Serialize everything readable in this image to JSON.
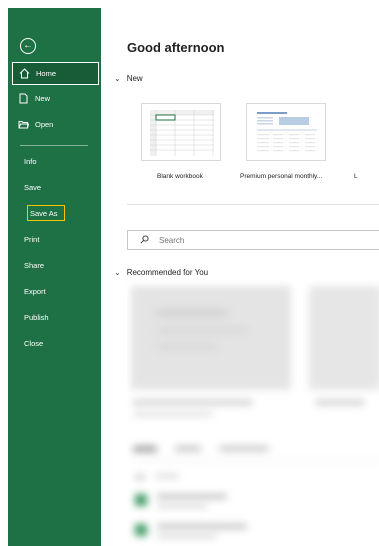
{
  "sidebar": {
    "back_icon": "back-arrow-icon",
    "top_items": [
      {
        "label": "Home",
        "icon": "home-icon",
        "selected": true
      },
      {
        "label": "New",
        "icon": "new-document-icon"
      },
      {
        "label": "Open",
        "icon": "folder-open-icon"
      }
    ],
    "items": [
      "Info",
      "Save",
      "Save As",
      "Print",
      "Share",
      "Export",
      "Publish",
      "Close"
    ],
    "highlighted_item": "Save As",
    "bg_color": "#1e7145",
    "selected_bg": "#185c37",
    "highlight_color": "#f5c400"
  },
  "main": {
    "greeting": "Good afternoon",
    "new_section": {
      "title": "New",
      "templates": [
        {
          "label": "Blank workbook"
        },
        {
          "label": "Premium personal monthly..."
        },
        {
          "label": "L"
        }
      ]
    },
    "search": {
      "placeholder": "Search",
      "icon": "search-icon"
    },
    "recommended_section": {
      "title": "Recommended for You"
    }
  }
}
